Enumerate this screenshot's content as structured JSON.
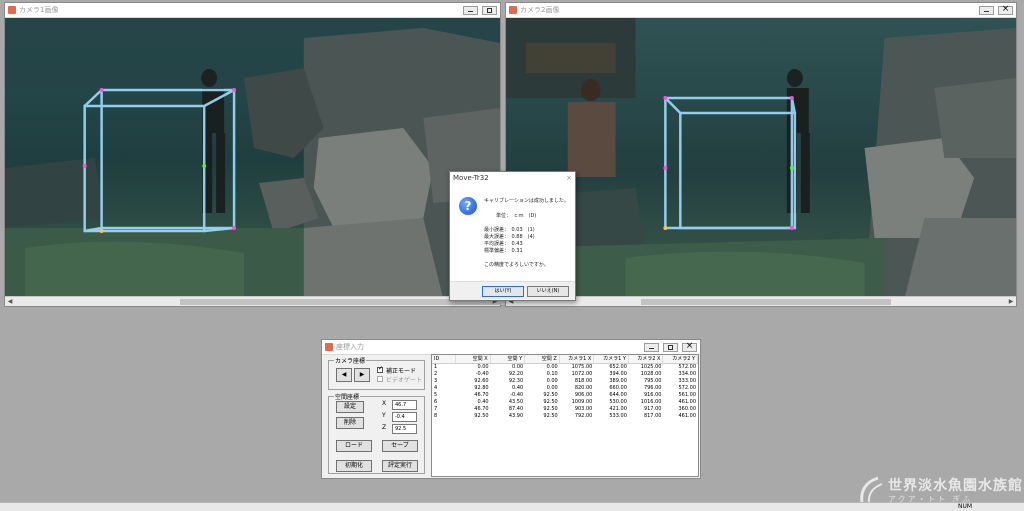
{
  "camera1": {
    "title": "カメラ1画像"
  },
  "camera2": {
    "title": "カメラ2画像"
  },
  "dialog": {
    "title": "Move-Tr32",
    "close": "×",
    "lines": [
      "キャリブレーションは成功しました。",
      "単位：　ｃｍ　(D)",
      "最小誤差：　0.03　(1)",
      "最大誤差：　0.88　(4)",
      "平均誤差：　0.43",
      "標準偏差：　0.31",
      "この精度でよろしいですか。"
    ],
    "yes": "はい(Y)",
    "no": "いいえ(N)"
  },
  "coord_window": {
    "title": "座標入力",
    "camera_coords_label": "カメラ座標",
    "correction_mode": "補正モード",
    "video_gate": "ビデオゲート",
    "space_coords_label": "空間座標",
    "set_button": "設定",
    "delete_button": "削除",
    "load_button": "ロード",
    "save_button": "セーブ",
    "init_button": "初期化",
    "eval_button": "評定実行",
    "x_label": "X",
    "y_label": "Y",
    "z_label": "Z",
    "x_value": "46.7",
    "y_value": "-0.4",
    "z_value": "92.5",
    "columns": [
      "ID",
      "空間 X",
      "空間 Y",
      "空間 Z",
      "カメラ1 X",
      "カメラ1 Y",
      "カメラ2 X",
      "カメラ2 Y"
    ],
    "rows": [
      [
        "1",
        "0.00",
        "0.00",
        "0.00",
        "1075.00",
        "652.00",
        "1025.00",
        "572.00"
      ],
      [
        "2",
        "-0.40",
        "92.20",
        "0.10",
        "1072.00",
        "394.00",
        "1028.00",
        "334.00"
      ],
      [
        "3",
        "92.60",
        "92.30",
        "0.00",
        "818.00",
        "389.00",
        "795.00",
        "333.00"
      ],
      [
        "4",
        "92.80",
        "0.40",
        "0.00",
        "820.00",
        "660.00",
        "796.00",
        "572.00"
      ],
      [
        "5",
        "46.70",
        "-0.40",
        "92.50",
        "906.00",
        "644.00",
        "916.00",
        "561.00"
      ],
      [
        "6",
        "0.40",
        "43.50",
        "92.50",
        "1009.00",
        "530.00",
        "1016.00",
        "461.00"
      ],
      [
        "7",
        "46.70",
        "87.40",
        "92.50",
        "903.00",
        "421.00",
        "917.00",
        "360.00"
      ],
      [
        "8",
        "92.50",
        "43.90",
        "92.50",
        "792.00",
        "533.00",
        "817.00",
        "461.00"
      ]
    ]
  },
  "logo": {
    "line1": "世界淡水魚園水族館",
    "line2": "アクア・トト ぎふ"
  },
  "status": {
    "num": "NUM"
  },
  "colors": {
    "frame": "#9fdcff",
    "water": "#1b3a3a",
    "accent": "#1b4fcf"
  }
}
